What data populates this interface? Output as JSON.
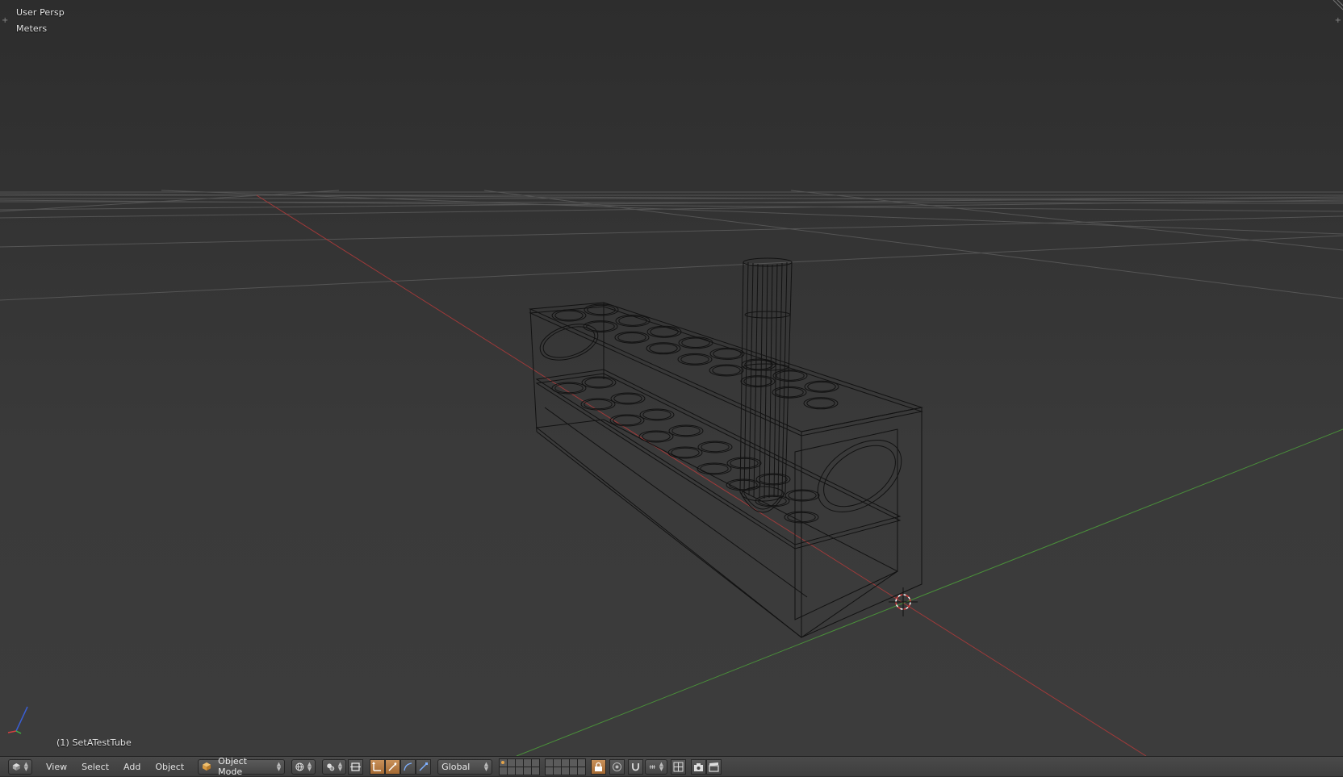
{
  "viewport": {
    "view_name": "User Persp",
    "units": "Meters",
    "object_label": "(1) SetATestTube"
  },
  "header": {
    "editor_type_icon": "cube-icon",
    "menus": [
      "View",
      "Select",
      "Add",
      "Object"
    ],
    "mode": {
      "icon": "cube-icon",
      "label": "Object Mode"
    },
    "viewport_shading_icon": "sphere-icon",
    "pivot_icon": "pivot-icon",
    "manipulator_icon": "manipulator-icon",
    "transform_icons": [
      "translate-icon",
      "rotate-icon",
      "scale-icon"
    ],
    "orientation": "Global",
    "layers_icon": "layers-icon",
    "lock_icon": "lock-icon",
    "proportional_icon": "proportional-icon",
    "snap_icons": [
      "magnet-icon",
      "snap-increment-icon",
      "snap-target-icon"
    ],
    "render_icons": [
      "camera-icon",
      "clapper-icon"
    ]
  },
  "colors": {
    "x_axis": "#b83a3a",
    "y_axis": "#4ea63a",
    "active_button": "#b97f45",
    "header_bg": "#434343"
  }
}
